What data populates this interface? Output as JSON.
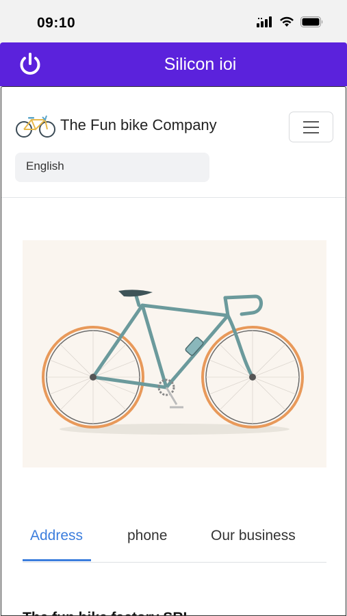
{
  "status_bar": {
    "time": "09:10",
    "icons": [
      "signal-icon",
      "wifi-icon",
      "battery-icon"
    ]
  },
  "app_bar": {
    "title": "Silicon ioi",
    "background_color": "#5b22dc",
    "left_icon": "power-icon"
  },
  "site_header": {
    "brand_name": "The Fun bike Company",
    "logo_icon": "bicycle-icon",
    "menu_icon": "hamburger-menu-icon",
    "language": {
      "selected": "English"
    }
  },
  "hero": {
    "image_icon": "bicycle-illustration"
  },
  "tabs": [
    {
      "label": "Address",
      "active": true
    },
    {
      "label": "phone",
      "active": false
    },
    {
      "label": "Our business",
      "active": false
    }
  ],
  "content": {
    "heading": "The fun bike factory SRL"
  },
  "colors": {
    "accent": "#3b7ddd",
    "brand_purple": "#5b22dc"
  }
}
